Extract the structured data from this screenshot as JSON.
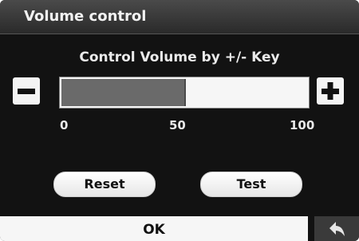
{
  "dialog": {
    "title": "Volume control",
    "subtitle": "Control Volume by +/- Key"
  },
  "volume": {
    "min_label": "0",
    "mid_label": "50",
    "max_label": "100",
    "level_percent": 50
  },
  "buttons": {
    "reset_label": "Reset",
    "test_label": "Test",
    "ok_label": "OK"
  },
  "icons": {
    "decrease": "minus-icon",
    "increase": "plus-icon",
    "back": "back-arrow-icon"
  }
}
